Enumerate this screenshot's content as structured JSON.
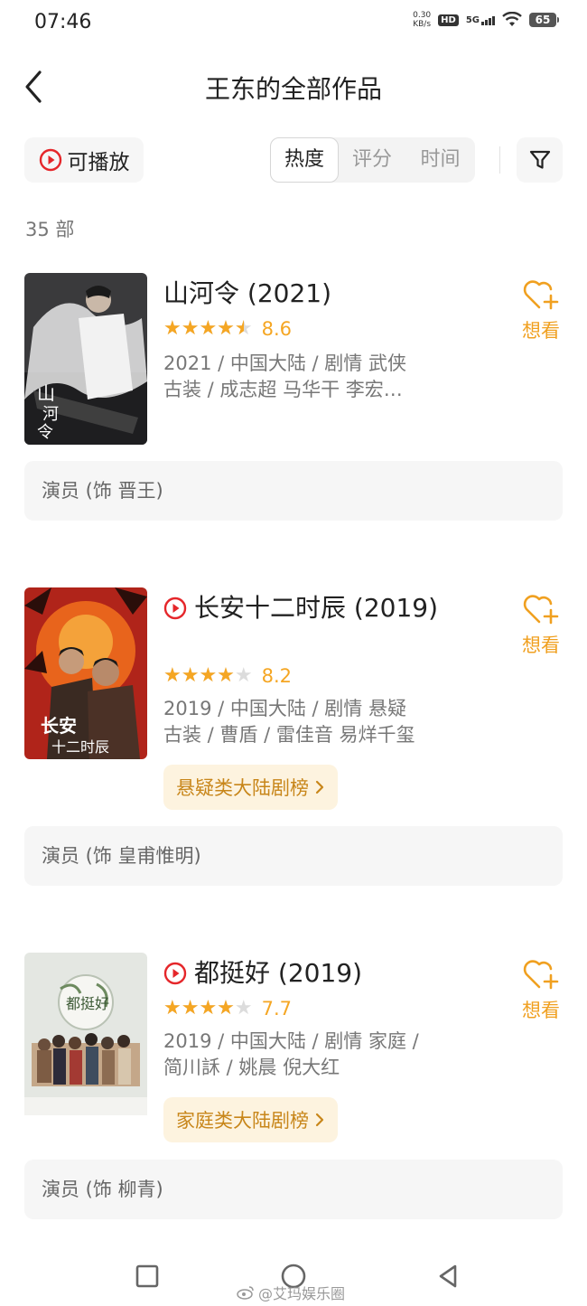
{
  "status_bar": {
    "time": "07:46",
    "net_speed": "0.30",
    "net_unit": "KB/s",
    "hd_label": "HD",
    "network_label": "5G",
    "battery": "65"
  },
  "header": {
    "title": "王东的全部作品"
  },
  "filters": {
    "playable_label": "可播放",
    "sort_tabs": [
      "热度",
      "评分",
      "时间"
    ],
    "active_tab": "热度"
  },
  "count_label": "35 部",
  "movies": [
    {
      "title": "山河令 (2021)",
      "playable": false,
      "rating": 4.5,
      "score": "8.6",
      "meta_line1": "2021 / 中国大陆 / 剧情 武侠",
      "meta_line2": "古装 / 成志超 马华干 李宏…",
      "want_label": "想看",
      "chart": null,
      "role": "演员 (饰 晋王)"
    },
    {
      "title": "长安十二时辰 (2019)",
      "playable": true,
      "rating": 4,
      "score": "8.2",
      "meta_line1": "2019 / 中国大陆 / 剧情 悬疑",
      "meta_line2": "古装 / 曹盾 / 雷佳音 易烊千玺",
      "want_label": "想看",
      "chart": "悬疑类大陆剧榜",
      "role": "演员 (饰 皇甫惟明)"
    },
    {
      "title": "都挺好 (2019)",
      "playable": true,
      "rating": 4,
      "score": "7.7",
      "meta_line1": "2019 / 中国大陆 / 剧情 家庭 /",
      "meta_line2": "简川訸 / 姚晨 倪大红",
      "want_label": "想看",
      "chart": "家庭类大陆剧榜",
      "role": "演员 (饰 柳青)"
    }
  ],
  "watermark": "@艾玛娱乐圈",
  "colors": {
    "accent": "#f5a623",
    "play_red": "#e5262a",
    "chart_bg": "#fdf3df",
    "chart_text": "#c8861a",
    "muted": "#777777"
  }
}
